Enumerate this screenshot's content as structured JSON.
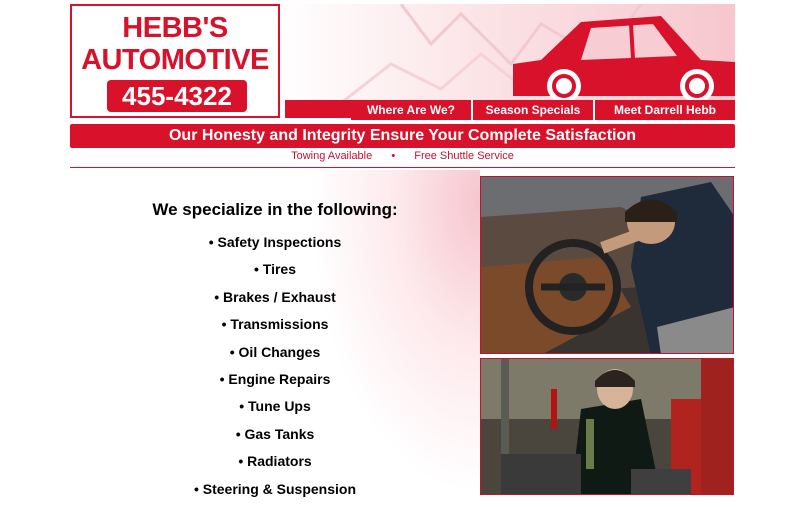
{
  "logo": {
    "line1": "HEBB'S",
    "line2": "AUTOMOTIVE",
    "phone": "455-4322"
  },
  "nav": {
    "items": [
      {
        "label": "Where Are We?"
      },
      {
        "label": "Season Specials"
      },
      {
        "label": "Meet Darrell Hebb"
      }
    ]
  },
  "banner": "Our Honesty and Integrity Ensure Your Complete Satisfaction",
  "services_bar": {
    "left": "Towing Available",
    "separator": "•",
    "right": "Free Shuttle Service"
  },
  "specialize": {
    "heading": "We specialize in the following:",
    "items": [
      "• Safety Inspections",
      "• Tires",
      "• Brakes / Exhaust",
      "• Transmissions",
      "• Oil Changes",
      "• Engine Repairs",
      "• Tune Ups",
      "• Gas Tanks",
      "• Radiators",
      "• Steering & Suspension"
    ]
  },
  "colors": {
    "brand_red": "#d8122b",
    "text": "#000000"
  },
  "icons": {
    "header_art": "car-silhouette-icon"
  }
}
